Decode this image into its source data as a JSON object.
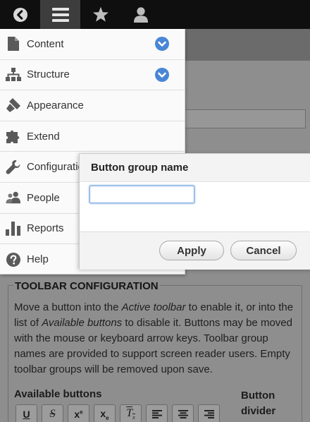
{
  "toolbar": {
    "buttons": [
      {
        "icon": "back-arrow-icon"
      },
      {
        "icon": "hamburger-menu-icon",
        "active": true
      },
      {
        "icon": "star-icon"
      },
      {
        "icon": "user-icon"
      }
    ]
  },
  "menu": {
    "items": [
      {
        "label": "Content",
        "icon": "document-icon",
        "expandable": true
      },
      {
        "label": "Structure",
        "icon": "sitemap-icon",
        "expandable": true
      },
      {
        "label": "Appearance",
        "icon": "paintbrush-icon"
      },
      {
        "label": "Extend",
        "icon": "puzzle-icon"
      },
      {
        "label": "Configuration",
        "icon": "wrench-icon"
      },
      {
        "label": "People",
        "icon": "people-icon"
      },
      {
        "label": "Reports",
        "icon": "bar-chart-icon"
      },
      {
        "label": "Help",
        "icon": "help-icon"
      }
    ]
  },
  "dialog": {
    "title": "Button group name",
    "input_value": "",
    "apply_label": "Apply",
    "cancel_label": "Cancel"
  },
  "page": {
    "legend": "TOOLBAR CONFIGURATION",
    "description": {
      "p1": "Move a button into the ",
      "em1": "Active toolbar",
      "p2": " to enable it, or into the list of ",
      "em2": "Available buttons",
      "p3": " to disable it. Buttons may be moved with the mouse or keyboard arrow keys. Toolbar group names are provided to support screen reader users. Empty toolbar groups will be removed upon save."
    },
    "available_label": "Available buttons",
    "divider_label": "Button divider",
    "editor_buttons": [
      "underline-icon",
      "strikethrough-icon",
      "superscript-icon",
      "subscript-icon",
      "remove-format-icon",
      "align-left-icon",
      "align-center-icon",
      "align-right-icon"
    ]
  },
  "colors": {
    "toolbar_bg": "#0f0f0f",
    "menu_bg": "#fafafa",
    "chevron_blue": "#4a86d6",
    "overlay_gray": "#8e8e8e"
  }
}
